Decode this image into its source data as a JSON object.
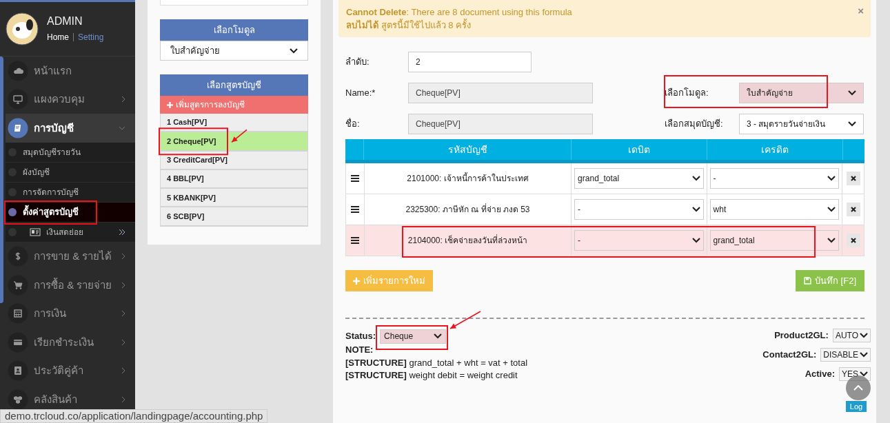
{
  "sidebar": {
    "user": {
      "name": "ADMIN",
      "links": [
        {
          "label": "Home",
          "selected": true
        },
        {
          "label": "Setting",
          "selected": false
        }
      ]
    },
    "items": [
      {
        "label": "หน้าแรก",
        "selected": false
      },
      {
        "label": "แผงควบคุม",
        "selected": false,
        "expanded": false
      },
      {
        "label": "การบัญชี",
        "selected": true,
        "expanded": true,
        "children": [
          {
            "label": "สมุดบัญชีรายวัน",
            "selected": false
          },
          {
            "label": "ผังบัญชี",
            "selected": false
          },
          {
            "label": "การจัดการบัญชี",
            "selected": false
          },
          {
            "label": "ตั้งค่าสูตรบัญชี",
            "selected": true,
            "highlighted": true
          },
          {
            "label": "เงินสดย่อย",
            "selected": false,
            "expanded": false
          }
        ]
      },
      {
        "label": "การขาย & รายได้",
        "selected": false,
        "expanded": false
      },
      {
        "label": "การซื้อ & รายจ่าย",
        "selected": false,
        "expanded": false
      },
      {
        "label": "การเงิน",
        "selected": false,
        "expanded": false
      },
      {
        "label": "เรียกชำระเงิน",
        "selected": false,
        "expanded": false
      },
      {
        "label": "ประวัติคู่ค้า",
        "selected": false,
        "expanded": false
      },
      {
        "label": "คลังสินค้า",
        "selected": false,
        "expanded": false
      }
    ]
  },
  "module_picker": {
    "title": "เลือกโมดูล",
    "value": "ใบสำคัญจ่าย"
  },
  "formula_list": {
    "title": "เลือกสูตรบัญชี",
    "add_label": "เพิ่มสูตรการลงบัญชี",
    "items": [
      {
        "label": "1 Cash[PV]",
        "selected": false
      },
      {
        "label": "2 Cheque[PV]",
        "selected": true,
        "highlighted": true,
        "arrow": true
      },
      {
        "label": "3 CreditCard[PV]",
        "selected": false
      },
      {
        "label": "4 BBL[PV]",
        "selected": false
      },
      {
        "label": "5 KBANK[PV]",
        "selected": false
      },
      {
        "label": "6 SCB[PV]",
        "selected": false
      }
    ]
  },
  "alert": {
    "lines": [
      "**Cannot Delete**: There are 8 document using this formula",
      "**ลบไม่ได้** สูตรนี้มีใช้ไปแล้ว 8 ครั้ง"
    ],
    "close": "×"
  },
  "form": {
    "order": {
      "label": "ลำดับ:",
      "value": "2"
    },
    "name": {
      "label": "Name:*",
      "value": "Cheque[PV]",
      "disabled": true
    },
    "name_th": {
      "label": "ชื่อ:",
      "value": "Cheque[PV]",
      "disabled": true
    },
    "module": {
      "label": "เลือกโมดูล:",
      "value": "ใบสำคัญจ่าย",
      "highlighted": true
    },
    "journal": {
      "label": "เลือกสมุดบัญชี:",
      "value": "3 - สมุดรายวันจ่ายเงิน"
    }
  },
  "table": {
    "columns": [
      "รหัสบัญชี",
      "เดบิต",
      "เครดิต"
    ],
    "rows": [
      {
        "account": "2101000: เจ้าหนี้การค้าในประเทศ",
        "debit": "grand_total",
        "credit": "-",
        "highlighted": false
      },
      {
        "account": "2325300: ภาษีหัก ณ ที่จ่าย ภงด 53",
        "debit": "-",
        "credit": "wht",
        "highlighted": false
      },
      {
        "account": "2104000: เช็คจ่ายลงวันที่ล่วงหน้า",
        "debit": "-",
        "credit": "grand_total",
        "highlighted": true
      }
    ]
  },
  "buttons": {
    "add": "เพิ่มรายการใหม่",
    "save": "บันทึก [F2]"
  },
  "footer": {
    "status": {
      "label": "Status:",
      "value": "Cheque",
      "highlighted": true,
      "arrow": true
    },
    "note": "NOTE:",
    "structures": [
      "**[STRUCTURE]** grand_total + wht = vat + total",
      "**[STRUCTURE]** weight debit = weight credit"
    ],
    "settings": [
      {
        "label": "Product2GL:",
        "value": "AUTO"
      },
      {
        "label": "Contact2GL:",
        "value": "DISABLE"
      },
      {
        "label": "Active:",
        "value": "YES"
      }
    ]
  },
  "log_tab": "Log",
  "status_bar": "demo.trcloud.co/application/landingpage/accounting.php"
}
